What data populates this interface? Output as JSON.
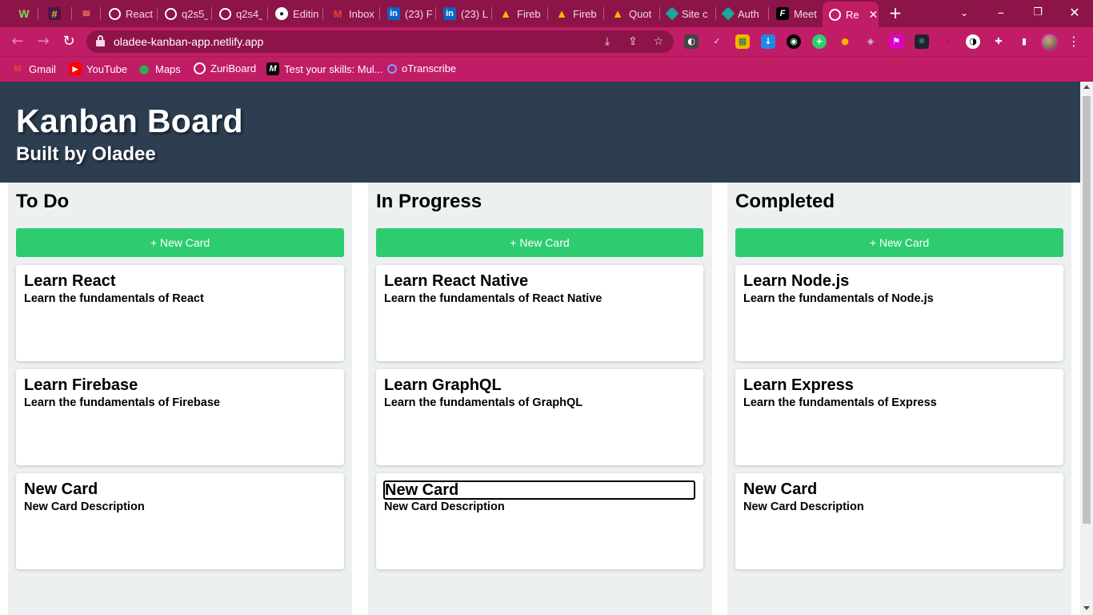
{
  "browser": {
    "tabs": [
      {
        "label": "",
        "icon": "w-icon"
      },
      {
        "label": "",
        "icon": "slack-icon"
      },
      {
        "label": "",
        "icon": "stack-icon"
      },
      {
        "label": "React",
        "icon": "globe-icon"
      },
      {
        "label": "q2s5_",
        "icon": "globe-icon"
      },
      {
        "label": "q2s4_",
        "icon": "globe-icon"
      },
      {
        "label": "Editin",
        "icon": "github-icon"
      },
      {
        "label": "Inbox",
        "icon": "gmail-icon"
      },
      {
        "label": "(23) F",
        "icon": "linkedin-icon"
      },
      {
        "label": "(23) L",
        "icon": "linkedin-icon"
      },
      {
        "label": "Fireb",
        "icon": "firebase-icon"
      },
      {
        "label": "Fireb",
        "icon": "firebase-icon"
      },
      {
        "label": "Quot",
        "icon": "firebase-icon"
      },
      {
        "label": "Site c",
        "icon": "netlify-icon"
      },
      {
        "label": "Auth",
        "icon": "netlify-icon"
      },
      {
        "label": "Meet",
        "icon": "f-icon"
      },
      {
        "label": "Re",
        "icon": "globe-icon",
        "active": true
      }
    ],
    "url": "oladee-kanban-app.netlify.app",
    "bookmarks": [
      {
        "label": "Gmail",
        "icon": "gmail-icon"
      },
      {
        "label": "YouTube",
        "icon": "youtube-icon"
      },
      {
        "label": "Maps",
        "icon": "maps-icon"
      },
      {
        "label": "ZuriBoard",
        "icon": "globe-icon"
      },
      {
        "label": "Test your skills: Mul...",
        "icon": "mdn-icon"
      },
      {
        "label": "oTranscribe",
        "icon": "circle-icon"
      }
    ]
  },
  "header": {
    "title": "Kanban Board",
    "subtitle": "Built by Oladee"
  },
  "columns": [
    {
      "title": "To Do",
      "button_label": "+ New Card",
      "cards": [
        {
          "title": "Learn React",
          "description": "Learn the fundamentals of React"
        },
        {
          "title": "Learn Firebase",
          "description": "Learn the fundamentals of Firebase"
        },
        {
          "title": "New Card",
          "description": "New Card Description"
        }
      ]
    },
    {
      "title": "In Progress",
      "button_label": "+ New Card",
      "cards": [
        {
          "title": "Learn React Native",
          "description": "Learn the fundamentals of React Native"
        },
        {
          "title": "Learn GraphQL",
          "description": "Learn the fundamentals of GraphQL"
        },
        {
          "title": "New Card",
          "description": "New Card Description",
          "editing": true
        }
      ]
    },
    {
      "title": "Completed",
      "button_label": "+ New Card",
      "cards": [
        {
          "title": "Learn Node.js",
          "description": "Learn the fundamentals of Node.js"
        },
        {
          "title": "Learn Express",
          "description": "Learn the fundamentals of Express"
        },
        {
          "title": "New Card",
          "description": "New Card Description"
        }
      ]
    }
  ],
  "colors": {
    "tabstrip": "#8d1448",
    "toolbar": "#c01d66",
    "header_bg": "#2c3e50",
    "column_bg": "#ecf0f1",
    "button_green": "#2ecc71"
  }
}
